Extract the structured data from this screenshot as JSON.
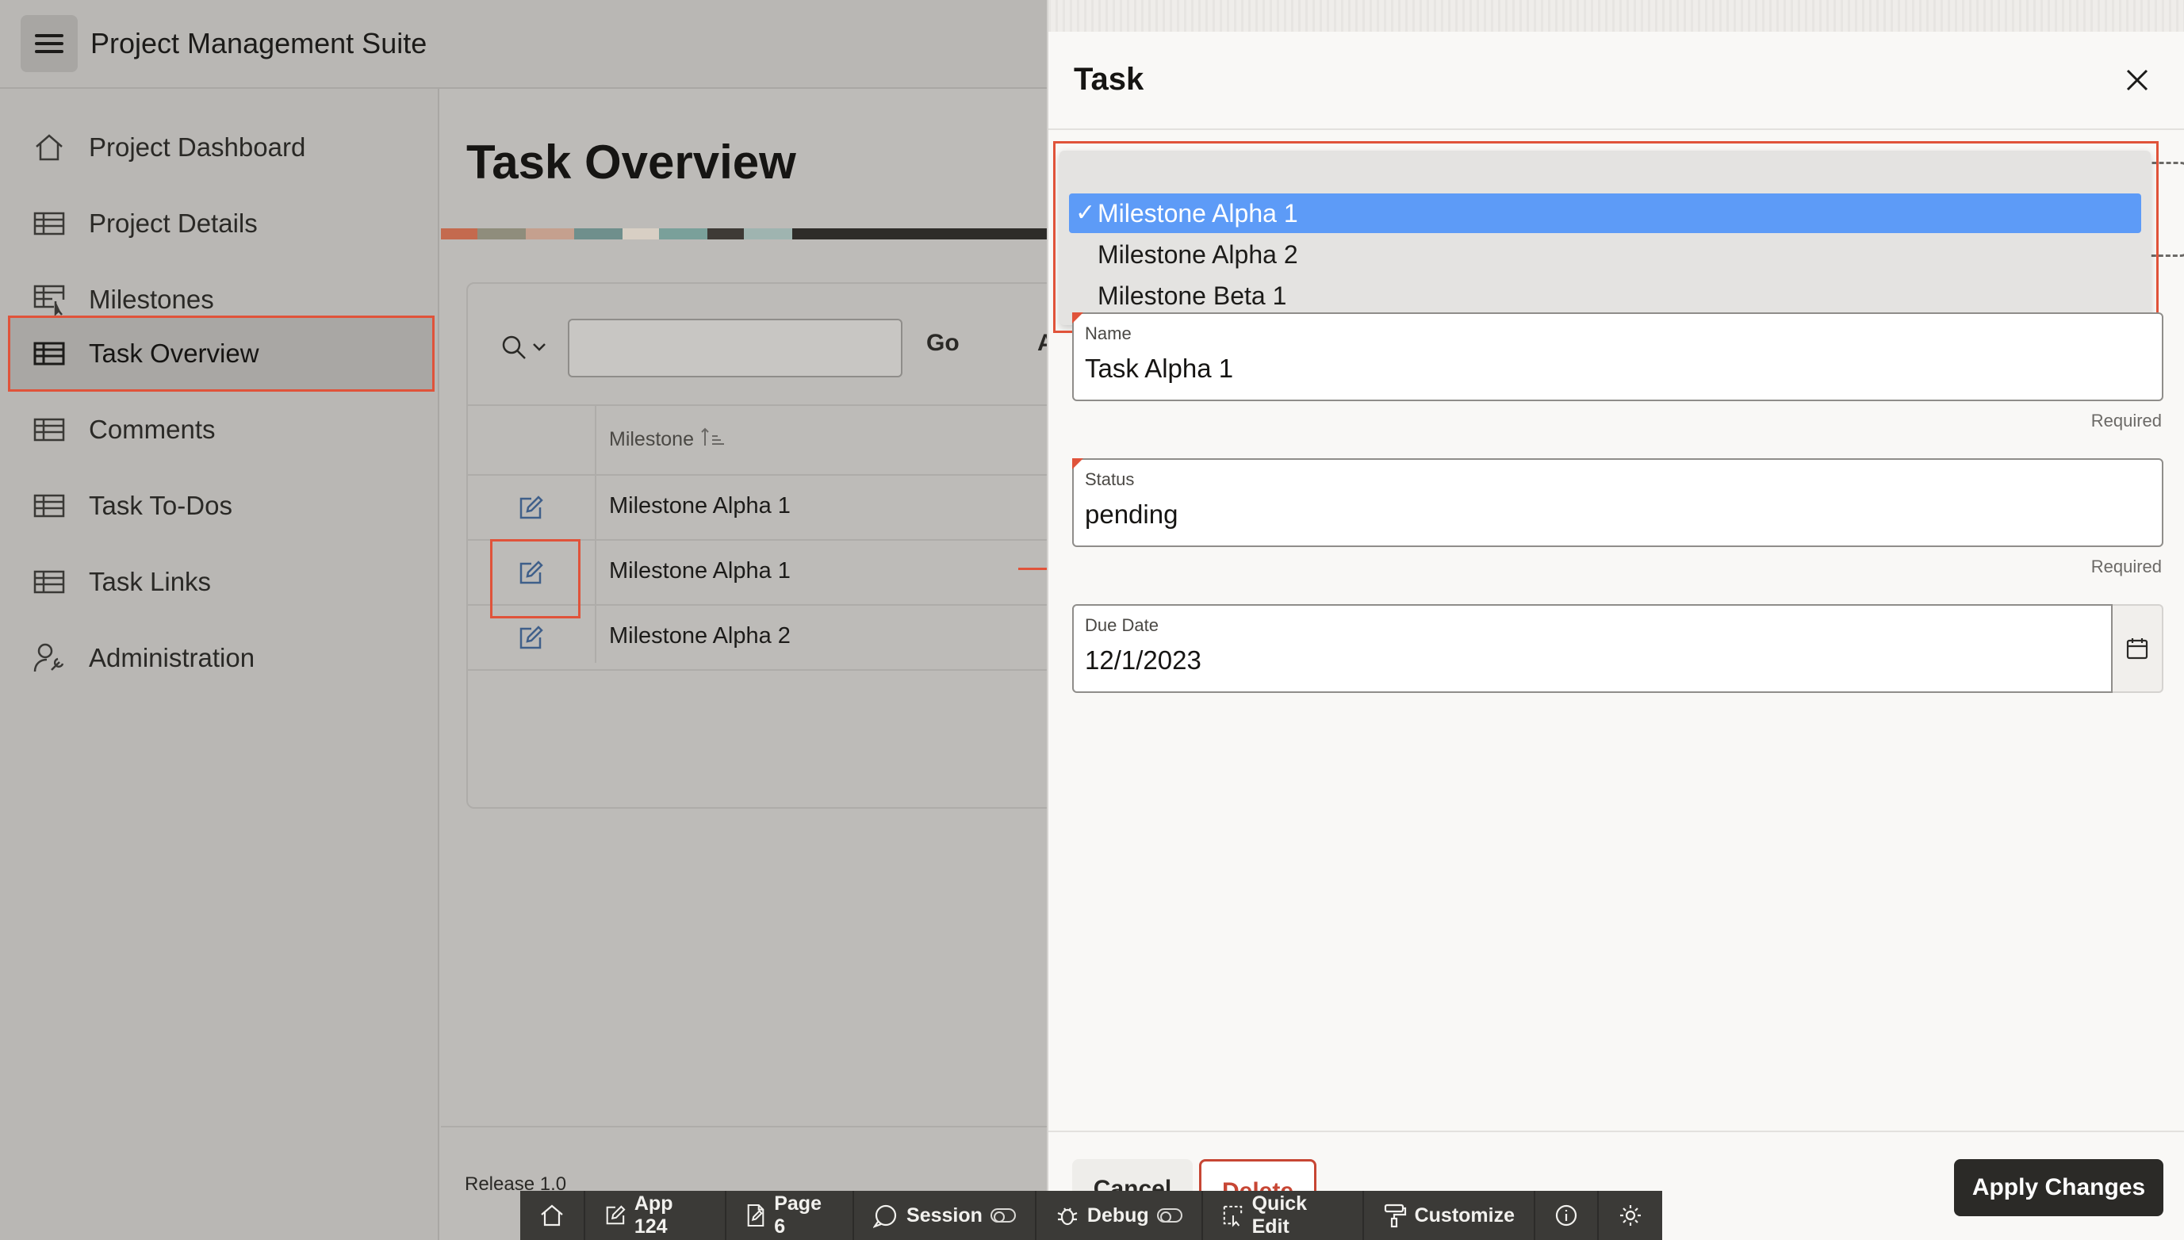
{
  "app": {
    "title": "Project Management Suite"
  },
  "sidebar": {
    "items": [
      {
        "label": "Project Dashboard",
        "icon": "home-icon"
      },
      {
        "label": "Project Details",
        "icon": "table-icon"
      },
      {
        "label": "Milestones",
        "icon": "table-pointer-icon"
      },
      {
        "label": "Task Overview",
        "icon": "table-icon",
        "active": true
      },
      {
        "label": "Comments",
        "icon": "table-icon"
      },
      {
        "label": "Task To-Dos",
        "icon": "table-icon"
      },
      {
        "label": "Task Links",
        "icon": "table-icon"
      },
      {
        "label": "Administration",
        "icon": "user-wrench-icon"
      }
    ]
  },
  "main": {
    "page_title": "Task Overview",
    "toolbar": {
      "go_label": "Go",
      "actions_label_partial": "A"
    },
    "grid": {
      "column_header": "Milestone",
      "rows": [
        "Milestone Alpha 1",
        "Milestone Alpha 1",
        "Milestone Alpha 2"
      ]
    },
    "release": "Release 1.0"
  },
  "drawer": {
    "title": "Task",
    "milestone_dropdown": {
      "options": [
        "Milestone Alpha 1",
        "Milestone Alpha 2",
        "Milestone Beta 1"
      ],
      "selected": "Milestone Alpha 1",
      "check": "✓"
    },
    "fields": {
      "name": {
        "label": "Name",
        "value": "Task Alpha 1",
        "required_text": "Required"
      },
      "status": {
        "label": "Status",
        "value": "pending",
        "required_text": "Required"
      },
      "due_date": {
        "label": "Due Date",
        "value": "12/1/2023"
      }
    },
    "buttons": {
      "cancel": "Cancel",
      "delete": "Delete",
      "apply": "Apply Changes"
    }
  },
  "dev_toolbar": {
    "app": "App 124",
    "page": "Page 6",
    "session": "Session",
    "debug": "Debug",
    "quick_edit": "Quick Edit",
    "customize": "Customize"
  },
  "colors": {
    "accent_highlight": "#e0533a",
    "selected_option": "#5d9bf7",
    "apply_button": "#2b2a27",
    "delete_text": "#c74634"
  }
}
